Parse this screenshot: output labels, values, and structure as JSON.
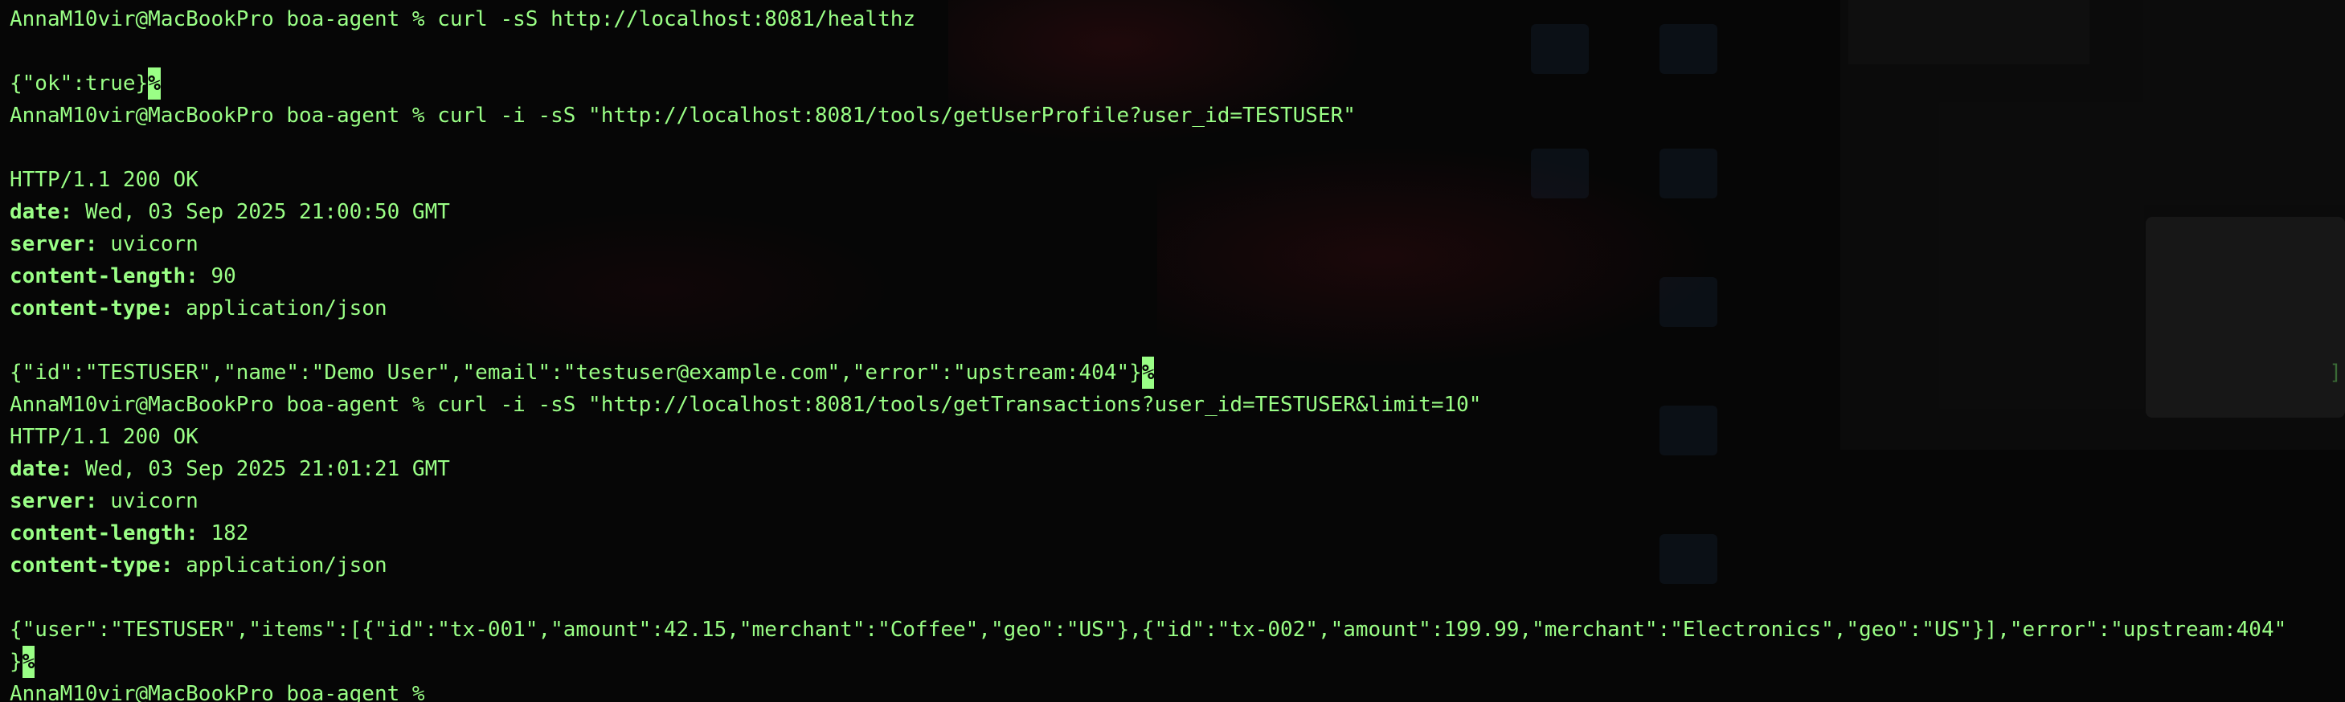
{
  "terminal": {
    "lines": [
      {
        "type": "cmd",
        "prompt": "AnnaM10vir@MacBookPro boa-agent % ",
        "command": "curl -sS http://localhost:8081/healthz"
      },
      {
        "type": "blank"
      },
      {
        "type": "body",
        "text": "{\"ok\":true}",
        "eol": "%"
      },
      {
        "type": "cmd",
        "prompt": "AnnaM10vir@MacBookPro boa-agent % ",
        "command": "curl -i -sS \"http://localhost:8081/tools/getUserProfile?user_id=TESTUSER\""
      },
      {
        "type": "blank"
      },
      {
        "type": "status",
        "text": "HTTP/1.1 200 OK"
      },
      {
        "type": "header",
        "key": "date",
        "value": "Wed, 03 Sep 2025 21:00:50 GMT"
      },
      {
        "type": "header",
        "key": "server",
        "value": "uvicorn"
      },
      {
        "type": "header",
        "key": "content-length",
        "value": "90"
      },
      {
        "type": "header",
        "key": "content-type",
        "value": "application/json"
      },
      {
        "type": "blank"
      },
      {
        "type": "body",
        "text": "{\"id\":\"TESTUSER\",\"name\":\"Demo User\",\"email\":\"testuser@example.com\",\"error\":\"upstream:404\"}",
        "eol": "%"
      },
      {
        "type": "cmd",
        "prompt": "AnnaM10vir@MacBookPro boa-agent % ",
        "command": "curl -i -sS \"http://localhost:8081/tools/getTransactions?user_id=TESTUSER&limit=10\""
      },
      {
        "type": "status",
        "text": "HTTP/1.1 200 OK"
      },
      {
        "type": "header",
        "key": "date",
        "value": "Wed, 03 Sep 2025 21:01:21 GMT"
      },
      {
        "type": "header",
        "key": "server",
        "value": "uvicorn"
      },
      {
        "type": "header",
        "key": "content-length",
        "value": "182"
      },
      {
        "type": "header",
        "key": "content-type",
        "value": "application/json"
      },
      {
        "type": "blank"
      },
      {
        "type": "body",
        "text": "{\"user\":\"TESTUSER\",\"items\":[{\"id\":\"tx-001\",\"amount\":42.15,\"merchant\":\"Coffee\",\"geo\":\"US\"},{\"id\":\"tx-002\",\"amount\":199.99,\"merchant\":\"Electronics\",\"geo\":\"US\"}],\"error\":\"upstream:404\""
      },
      {
        "type": "body",
        "text": "}",
        "eol": "%"
      },
      {
        "type": "prompt",
        "prompt": "AnnaM10vir@MacBookPro boa-agent % "
      }
    ],
    "bracket_char": "]"
  },
  "colors": {
    "text": "#9aff86",
    "background": "#060606"
  }
}
